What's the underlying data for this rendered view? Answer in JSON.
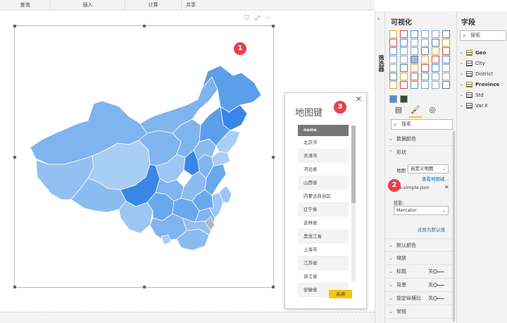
{
  "ribbon": {
    "tabs": [
      "查询",
      "插入",
      "计算",
      "共享"
    ]
  },
  "map": {
    "tools": {
      "filter": "⛉",
      "focus": "⤢",
      "more": "⋯"
    }
  },
  "badges": [
    "1",
    "2",
    "3"
  ],
  "legend": {
    "title": "地图键",
    "close": "✕",
    "header": "name",
    "rows": [
      "北京市",
      "天津市",
      "河北省",
      "山西省",
      "内蒙古自治区",
      "辽宁省",
      "吉林省",
      "黑龙江省",
      "上海市",
      "江苏省",
      "浙江省",
      "安徽省"
    ],
    "button": "关闭"
  },
  "filters": {
    "label": "筛选器"
  },
  "viz": {
    "title": "可视化",
    "collapse": "‹",
    "search_placeholder": "搜索",
    "sections": {
      "data_colors": "数据颜色",
      "shape": "形状",
      "default_color": "默认颜色",
      "zoom": "缩放",
      "title": "标题",
      "background": "背景",
      "lock_aspect": "锁定纵横比",
      "general": "常规"
    },
    "map_label": "地图",
    "map_value": "自定义地图",
    "view_map_keys": "查看地图键...",
    "file_name": "china-simple.json",
    "projection_label": "投影:",
    "projection_value": "Mercator",
    "reset": "还原为默认值",
    "off": "关"
  },
  "fields": {
    "title": "字段",
    "search_placeholder": "搜索",
    "items": [
      "Geo",
      "City",
      "District",
      "Province",
      "Std",
      "Var.X"
    ]
  },
  "colors": {
    "accent": "#f2c811",
    "badge": "#e8404a",
    "map_base": "#7fb4ee",
    "map_dark": "#3a86e8",
    "map_light": "#a9cef5"
  }
}
